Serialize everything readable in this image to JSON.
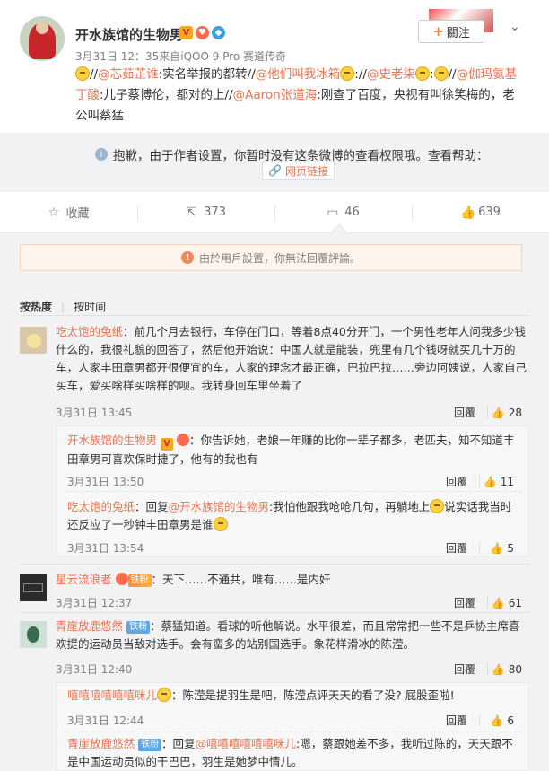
{
  "post": {
    "author": "开水族馆的生物男",
    "meta": "3月31日 12：35来自iQOO 9 Pro 赛道传奇",
    "follow_label": "關注",
    "text_parts": [
      {
        "t": "//"
      },
      {
        "t": "@芯茹芷谁",
        "link": true
      },
      {
        "t": ":实名举报的都转//"
      },
      {
        "t": "@他们叫我冰箱",
        "link": true
      },
      {
        "t": ":"
      },
      {
        "t": "//"
      },
      {
        "t": "@史老柒",
        "link": true
      },
      {
        "t": ":"
      },
      {
        "t": "//"
      },
      {
        "t": "@伽玛氨基丁酸",
        "link": true
      },
      {
        "t": ":儿子蔡博伦，都对的上//"
      },
      {
        "t": "@Aaron张道海",
        "link": true
      },
      {
        "t": ":刚查了百度，央视有叫徐笑梅的，老公叫蔡猛"
      }
    ]
  },
  "forward": {
    "notice": "抱歉，由于作者设置，你暂时没有这条微博的查看权限哦。查看帮助：",
    "weblink": "网页链接"
  },
  "actions": {
    "favorite": "收藏",
    "repost": "373",
    "comment": "46",
    "like": "639"
  },
  "comments_section": {
    "notice": "由於用戶設置，你無法回覆評論。",
    "sort_hot": "按热度",
    "sort_time": "按时间",
    "reply_label": "回覆"
  },
  "comments": [
    {
      "user": "吃太饱的兔纸",
      "text": "：前几个月去银行，车停在门口，等着8点40分开门，一个男性老年人问我多少钱什么的，我很礼貌的回答了，然后他开始说：中国人就是能装，兜里有几个钱呀就买几十万的车，人家丰田章男都开很便宜的车，人家的理念才最正确，巴拉巴拉……旁边阿姨说，人家自己买车，爱买啥样买啥样的呗。我转身回车里坐着了",
      "time": "3月31日 13:45",
      "likes": "28",
      "replies": [
        {
          "user": "开水族馆的生物男",
          "text": "：你告诉她，老娘一年赚的比你一辈子都多，老匹夫，知不知道丰田章男可喜欢保时捷了，他有的我也有",
          "time": "3月31日 13:50",
          "likes": "11"
        },
        {
          "user": "吃太饱的兔纸",
          "text_pre": "：回复",
          "mention": "@开水族馆的生物男",
          "text_post": ":我怕他跟我呛呛几句，再躺地上",
          "text_post2": "说实话我当时还反应了一秒钟丰田章男是谁",
          "time": "3月31日 13:54",
          "likes": "5"
        }
      ]
    },
    {
      "user": "星云流浪者",
      "tag": "铁粉",
      "text": "：天下……不通共，唯有……是内奸",
      "time": "3月31日 12:37",
      "likes": "61"
    },
    {
      "user": "青崖放鹿悠然",
      "tag": "铁粉",
      "text": "：蔡猛知道。看球的听他解说。水平很差，而且常常把一些不是乒协主席喜欢提的运动员当敌对选手。会有蛮多的站别国选手。象花样滑冰的陈滢。",
      "time": "3月31日 12:40",
      "likes": "80",
      "replies": [
        {
          "user": "嘻嘻嘻嘻嘻嘻咪儿",
          "text": "：陈滢是提羽生是吧，陈滢点评天天的看了没? 屁股歪啦!",
          "time": "3月31日 12:44",
          "likes": "6"
        },
        {
          "user": "青崖放鹿悠然",
          "tag": "铁粉",
          "text_pre": "：回复",
          "mention": "@嘻嘻嘻嘻嘻嘻咪儿",
          "text_post": ":嗯，蔡跟她差不多，我听过陈的，天天跟不是中国运动员似的干巴巴，羽生是她梦中情儿。"
        }
      ]
    }
  ]
}
